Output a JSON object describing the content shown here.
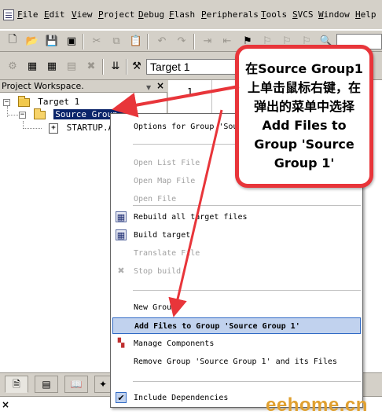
{
  "menubar": {
    "items": [
      "File",
      "Edit",
      "View",
      "Project",
      "Debug",
      "Flash",
      "Peripherals",
      "Tools",
      "SVCS",
      "Window",
      "Help"
    ]
  },
  "toolbar2": {
    "target_value": "Target 1"
  },
  "workspace": {
    "title": "Project Workspace",
    "tree": {
      "target": "Target 1",
      "group": "Source Group 1",
      "file": "STARTUP.A"
    }
  },
  "editor": {
    "line_number": "1"
  },
  "context_menu": {
    "items": [
      {
        "label": "Options for Group 'Source Group 1'",
        "enabled": true
      },
      {
        "label": "Open List File",
        "enabled": false
      },
      {
        "label": "Open Map File",
        "enabled": false
      },
      {
        "label": "Open File",
        "enabled": false
      },
      {
        "label": "Rebuild all target files",
        "enabled": true
      },
      {
        "label": "Build target",
        "enabled": true
      },
      {
        "label": "Translate File",
        "enabled": false
      },
      {
        "label": "Stop build",
        "enabled": false
      },
      {
        "label": "New Group",
        "enabled": true
      },
      {
        "label": "Add Files to Group 'Source Group 1'",
        "enabled": true,
        "highlighted": true
      },
      {
        "label": "Manage Components",
        "enabled": true
      },
      {
        "label": "Remove Group 'Source Group 1' and its Files",
        "enabled": true
      },
      {
        "label": "Include Dependencies",
        "enabled": true,
        "checked": true
      }
    ]
  },
  "callout": {
    "text": "在Source Group1上单击鼠标右键，在弹出的菜单中选择Add Files to Group 'Source Group 1'"
  },
  "watermark": "eehome.cn",
  "colors": {
    "callout_border": "#e8353a",
    "arrow": "#e8353a",
    "selection": "#0a246a",
    "menu_highlight": "#c1d2ee",
    "watermark": "#e0a030"
  }
}
